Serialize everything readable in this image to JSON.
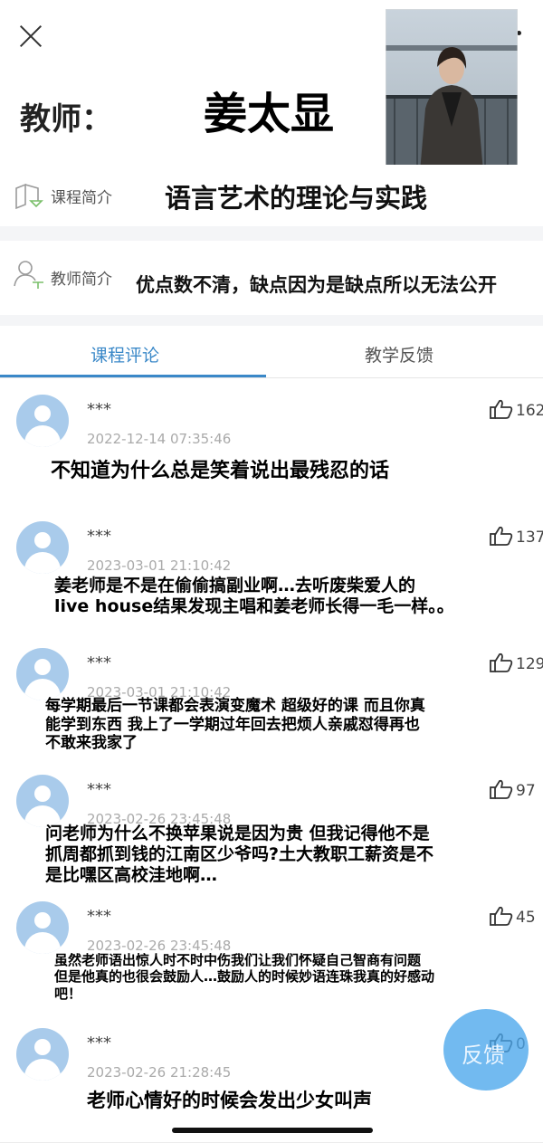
{
  "header": {
    "close_icon": "close-icon",
    "teacher_label": "教师：",
    "teacher_name": "姜太显"
  },
  "course_intro": {
    "label": "课程简介",
    "value": "语言艺术的理论与实践",
    "icon": "book-icon"
  },
  "teacher_intro": {
    "label": "教师简介",
    "value": "优点数不清，缺点因为是缺点所以无法公开",
    "icon": "person-icon"
  },
  "tabs": [
    {
      "label": "课程评论",
      "active": true
    },
    {
      "label": "教学反馈",
      "active": false
    }
  ],
  "colors": {
    "accent": "#3a88c8",
    "avatar": "#a9cbeb",
    "fab": "#4aa7ec"
  },
  "comments": [
    {
      "user": "***",
      "time": "2022-12-14 07:35:46",
      "likes": "162",
      "text": "不知道为什么总是笑着说出最残忍的话"
    },
    {
      "user": "***",
      "time": "2023-03-01 21:10:42",
      "likes": "137",
      "text": "姜老师是不是在偷偷搞副业啊…去听废柴爱人的\nlive house结果发现主唱和姜老师长得一毛一样。。"
    },
    {
      "user": "***",
      "time": "2023-03-01 21:10:42",
      "likes": "129",
      "text": "每学期最后一节课都会表演变魔术 超级好的课 而且你真\n能学到东西 我上了一学期过年回去把烦人亲戚怼得再也\n不敢来我家了"
    },
    {
      "user": "***",
      "time": "2023-02-26 23:45:48",
      "likes": "97",
      "text": "问老师为什么不换苹果说是因为贵 但我记得他不是\n抓周都抓到钱的江南区少爷吗?土大教职工薪资是不\n是比嘿区高校洼地啊…"
    },
    {
      "user": "***",
      "time": "2023-02-26 23:45:48",
      "likes": "45",
      "text": "虽然老师语出惊人时不时中伤我们让我们怀疑自己智商有问题\n但是他真的也很会鼓励人…鼓励人的时候妙语连珠我真的好感动\n吧！"
    },
    {
      "user": "***",
      "time": "2023-02-26 21:28:45",
      "likes": "0",
      "text": "老师心情好的时候会发出少女叫声"
    }
  ],
  "fab": {
    "label": "反馈"
  }
}
